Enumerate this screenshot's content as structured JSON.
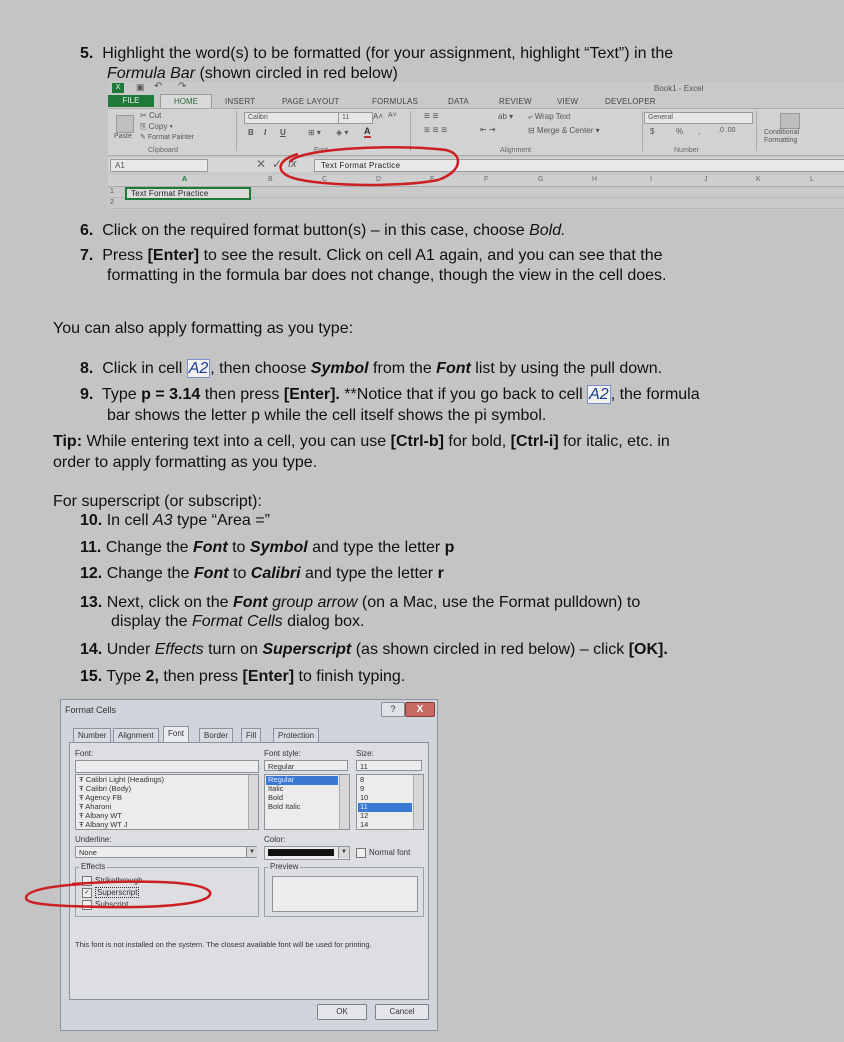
{
  "step5": {
    "num": "5.",
    "text_a": "Highlight the word(s) to be formatted (for your assignment, highlight “Text”)  in the",
    "text_b_italic": "Formula Bar",
    "text_b_rest": " (shown circled in red below)"
  },
  "excel": {
    "qat_icons": [
      "excel-logo-icon",
      "save-icon",
      "undo-icon",
      "redo-icon"
    ],
    "window_title": "Book1 - Excel",
    "tab_file": "FILE",
    "tabs": [
      "HOME",
      "INSERT",
      "PAGE LAYOUT",
      "FORMULAS",
      "DATA",
      "REVIEW",
      "VIEW",
      "DEVELOPER"
    ],
    "clipboard": {
      "paste": "Paste",
      "cut": "Cut",
      "copy": "Copy",
      "format_painter": "Format Painter",
      "group": "Clipboard"
    },
    "font": {
      "name": "Calibri",
      "size": "11",
      "bold": "B",
      "italic": "I",
      "underline": "U",
      "grow": "A˄",
      "shrink": "A˅",
      "color_a": "A",
      "group": "Font"
    },
    "alignment": {
      "wrap": "Wrap Text",
      "merge": "Merge & Center",
      "group": "Alignment"
    },
    "number": {
      "format": "General",
      "currency": "$",
      "percent": "%",
      "comma": ",",
      "group": "Number"
    },
    "styles": {
      "conditional_1": "Conditional",
      "conditional_2": "Formatting"
    },
    "name_box": "A1",
    "fx": "fx",
    "formula_text": "Text Format Practice",
    "columns": [
      "A",
      "B",
      "C",
      "D",
      "E",
      "F",
      "G",
      "H",
      "I",
      "J",
      "K",
      "L"
    ],
    "rows": [
      "1",
      "2"
    ],
    "cell_a1": "Text Format Practice"
  },
  "step6": {
    "num": "6.",
    "text": "Click on the required format button(s) – in this case, choose ",
    "italic": "Bold."
  },
  "step7": {
    "num": "7.",
    "line1_a": "Press ",
    "line1_b": "[Enter]",
    "line1_c": " to see the result. Click on cell A1 again, and you can see that the",
    "line2": "formatting in the formula bar does not change, though the view in the cell does."
  },
  "intro_as_you_type": "You can also apply formatting as you type:",
  "step8": {
    "num": "8.",
    "a": "Click in cell ",
    "cell": "A2",
    "b": ", then choose ",
    "symbol": "Symbol",
    "c": " from the ",
    "font": "Font",
    "d": " list by using the pull down."
  },
  "step9": {
    "num": "9.",
    "a": "Type ",
    "b": "p = 3.14",
    "c": " then press ",
    "d": "[Enter].",
    "e": " **Notice that if you go back to cell ",
    "cell": "A2",
    "f": ", the formula",
    "line2": "bar shows the letter p while the cell itself shows the pi symbol."
  },
  "tip": {
    "label": "Tip:",
    "a": " While entering text into a cell, you can use ",
    "b": "[Ctrl-b]",
    "c": " for bold, ",
    "d": "[Ctrl-i]",
    "e": " for italic, etc. in",
    "line2": "order to apply formatting as you type."
  },
  "superscript_intro": "For superscript (or subscript):",
  "step10": {
    "num": "10.",
    "a": "In cell ",
    "cell": "A3",
    "b": " type “Area =”"
  },
  "step11": {
    "num": "11.",
    "a": "Change the ",
    "font": "Font",
    "b": " to ",
    "symbol": "Symbol",
    "c": " and type the letter ",
    "letter": "p"
  },
  "step12": {
    "num": "12.",
    "a": "Change the ",
    "font": "Font",
    "b": " to ",
    "calibri": "Calibri",
    "c": " and type the letter ",
    "letter": "r"
  },
  "step13": {
    "num": "13.",
    "a": "Next, click on the ",
    "font": "Font",
    "b": " group arrow",
    "c": " (on a Mac, use the Format pulldown) to",
    "line2_a": "display the ",
    "line2_b": "Format Cells",
    "line2_c": " dialog box."
  },
  "step14": {
    "num": "14.",
    "a": "Under ",
    "effects": "Effects",
    "b": " turn on ",
    "superscript": "Superscript",
    "c": " (as shown circled in red below) – click ",
    "ok": "[OK]."
  },
  "step15": {
    "num": "15.",
    "a": "Type ",
    "two": "2,",
    "b": " then press ",
    "enter": "[Enter]",
    "c": " to finish typing."
  },
  "dialog": {
    "title": "Format Cells",
    "help": "?",
    "close": "X",
    "tabs": [
      "Number",
      "Alignment",
      "Font",
      "Border",
      "Fill",
      "Protection"
    ],
    "font_label": "Font:",
    "font_style_label": "Font style:",
    "size_label": "Size:",
    "font_style_value": "Regular",
    "size_value": "11",
    "font_list": [
      "Calibri Light (Headings)",
      "Calibri (Body)",
      "Agency FB",
      "Aharoni",
      "Albany WT",
      "Albany WT J"
    ],
    "style_list": [
      "Regular",
      "Italic",
      "Bold",
      "Bold Italic"
    ],
    "size_list": [
      "8",
      "9",
      "10",
      "11",
      "12",
      "14"
    ],
    "underline_label": "Underline:",
    "underline_value": "None",
    "color_label": "Color:",
    "normal_font": "Normal font",
    "effects_label": "Effects",
    "strikethrough": "Strikethrough",
    "superscript": "Superscript",
    "subscript": "Subscript",
    "checkmark": "✓",
    "preview_label": "Preview",
    "info": "This font is not installed on the system.  The closest available font will be used for printing.",
    "ok": "OK",
    "cancel": "Cancel",
    "highlight_color": "#3a78d4"
  },
  "annotation_color": "#cc1f24"
}
